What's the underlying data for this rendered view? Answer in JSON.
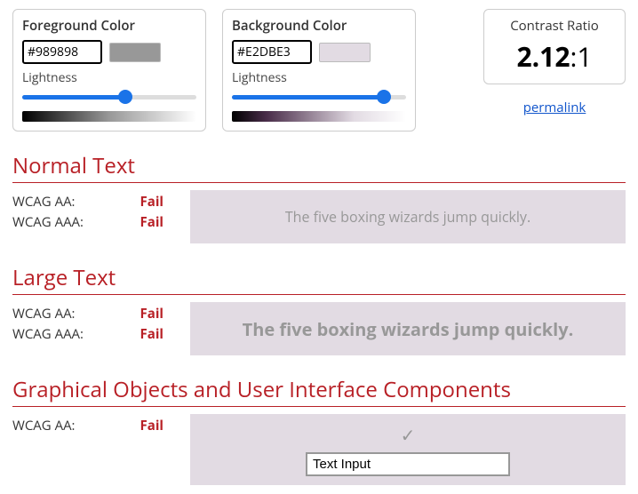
{
  "foreground": {
    "title": "Foreground Color",
    "hex": "#989898",
    "lightness_label": "Lightness",
    "lightness_pct": 59
  },
  "background": {
    "title": "Background Color",
    "hex": "#E2DBE3",
    "lightness_label": "Lightness",
    "lightness_pct": 87
  },
  "contrast": {
    "title": "Contrast Ratio",
    "value": "2.12",
    "suffix": ":1",
    "permalink": "permalink"
  },
  "sections": {
    "normal": {
      "heading": "Normal Text",
      "aa_label": "WCAG AA:",
      "aa_result": "Fail",
      "aaa_label": "WCAG AAA:",
      "aaa_result": "Fail",
      "sample": "The five boxing wizards jump quickly."
    },
    "large": {
      "heading": "Large Text",
      "aa_label": "WCAG AA:",
      "aa_result": "Fail",
      "aaa_label": "WCAG AAA:",
      "aaa_result": "Fail",
      "sample": "The five boxing wizards jump quickly."
    },
    "ui": {
      "heading": "Graphical Objects and User Interface Components",
      "aa_label": "WCAG AA:",
      "aa_result": "Fail",
      "check_glyph": "✓",
      "input_value": "Text Input"
    }
  }
}
